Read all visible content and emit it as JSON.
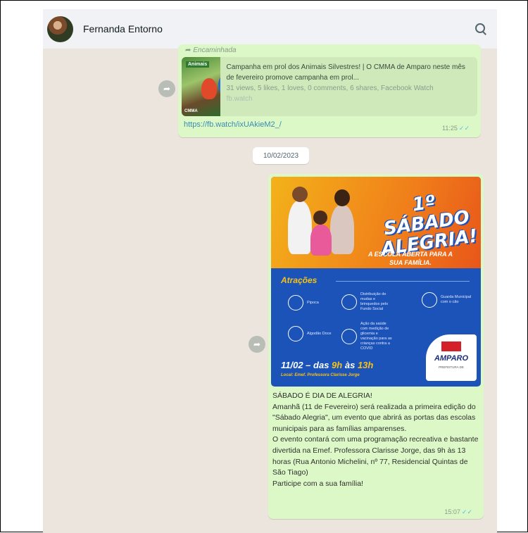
{
  "header": {
    "contact_name": "Fernanda Entorno",
    "search_icon": "search-icon"
  },
  "forwarded_message": {
    "forward_label": "Encaminhada",
    "preview": {
      "thumb_tag": "Animais",
      "thumb_foot": "CMMA",
      "title": "Campanha em prol dos Animais Silvestres! | O CMMA de Amparo neste mês de fevereiro promove campanha em prol...",
      "stats": "31 views, 5 likes, 1 loves, 0 comments, 6 shares, Facebook Watch",
      "source": "fb.watch"
    },
    "link": "https://fb.watch/ixUAkieM2_/",
    "time": "11:25",
    "ticks": "✓✓"
  },
  "date_divider": "10/02/2023",
  "image_message": {
    "flyer": {
      "title_line1": "1º SÁBADO",
      "title_line2": "ALEGRIA!",
      "subtitle": "A ESCOLA ABERTA PARA A SUA FAMÍLIA.",
      "section": "Atrações",
      "attractions": [
        "Pipoca",
        "Distribuição de mudas e brinquedos pelo Fundo Social",
        "Guarda Municipal com o cão",
        "Algodão Doce",
        "Ação da saúde com medição de glicemia e vacinação para as crianças contra a COVID"
      ],
      "date_prefix": "11/02 – das",
      "hour1": "9h",
      "date_mid": "às",
      "hour2": "13h",
      "local": "Local: Emef. Professora Clarisse Jorge",
      "logo_text": "AMPARO",
      "logo_small": "PREFEITURA DE"
    },
    "caption": [
      "SÁBADO É DIA DE ALEGRIA!",
      "Amanhã (11 de Fevereiro) será realizada a primeira edição do \"Sábado Alegria\", um evento que abrirá as portas das escolas municipais para as famílias amparenses.",
      "O evento contará com uma programação recreativa e bastante divertida na Emef. Professora Clarisse Jorge, das 9h às 13 horas (Rua Antonio Michelini, nº 77, Residencial Quintas de São Tiago)",
      "Participe com a sua família!"
    ],
    "time": "15:07",
    "ticks": "✓✓"
  }
}
